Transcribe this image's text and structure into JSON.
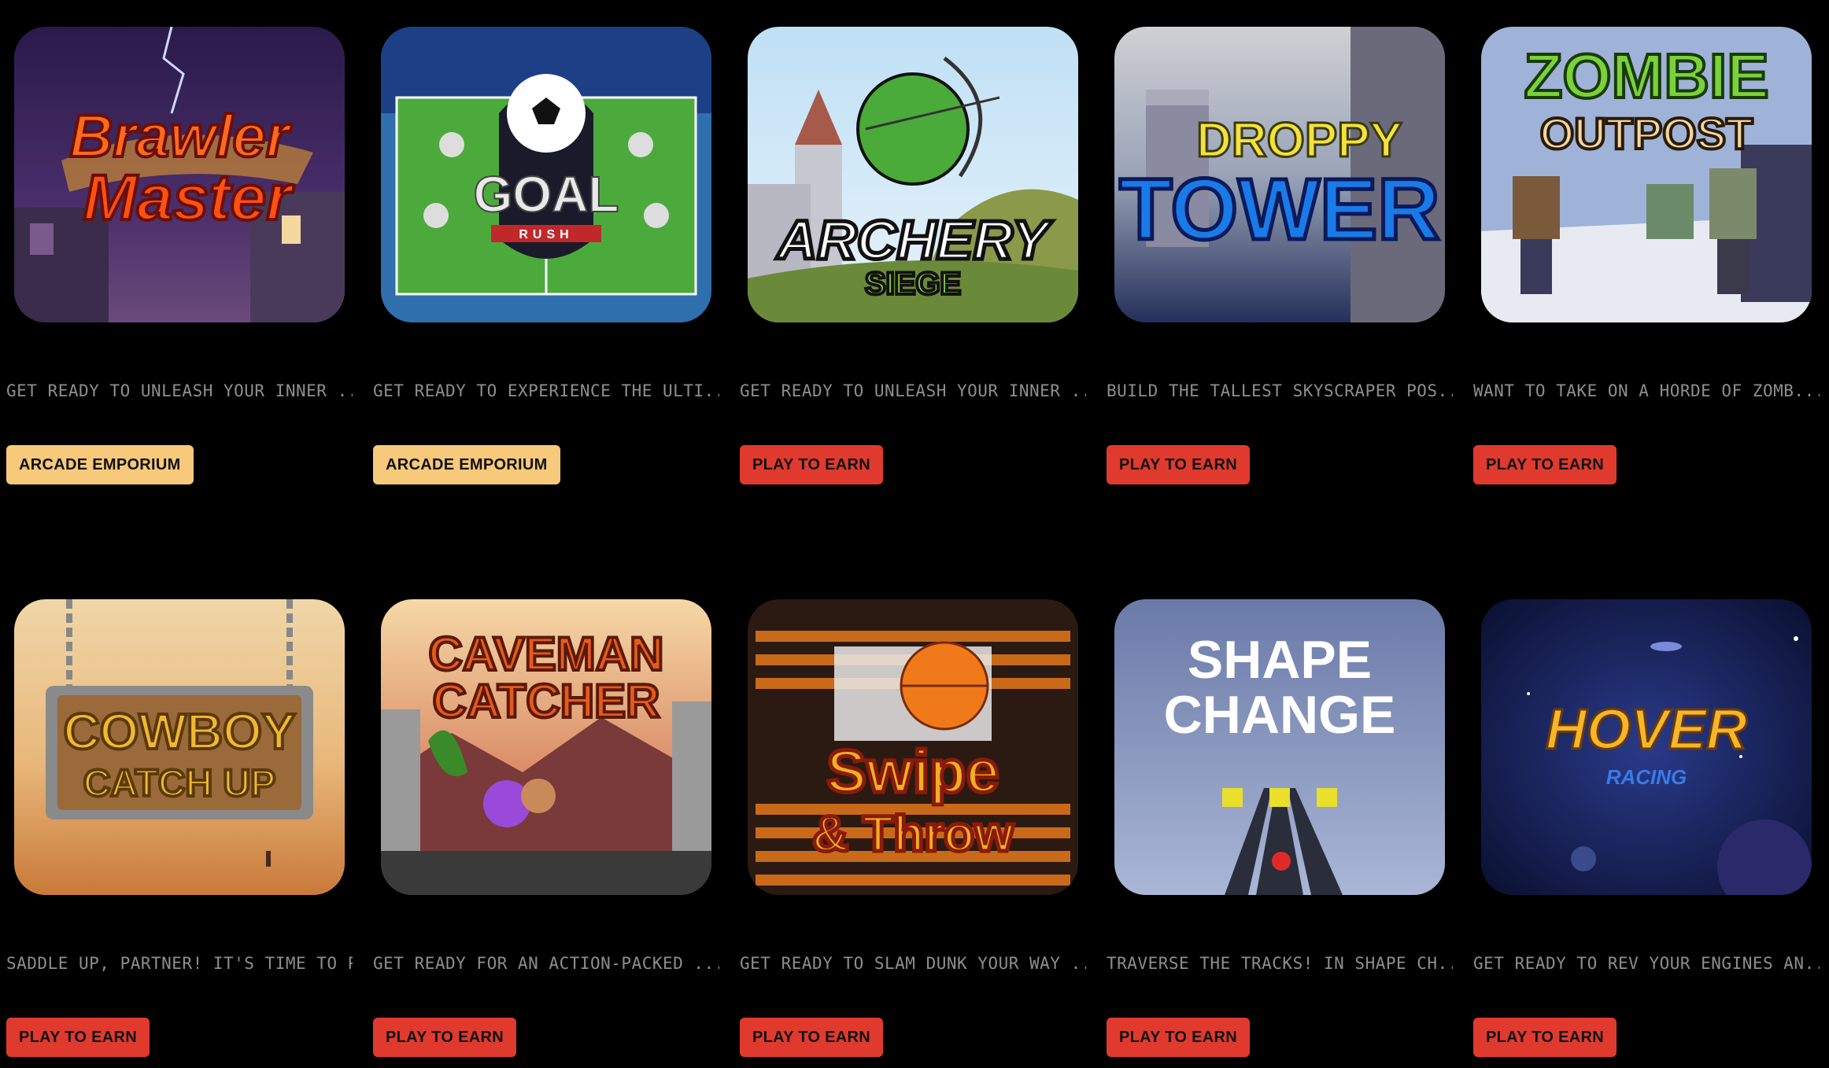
{
  "games": [
    {
      "title_line1": "Brawler",
      "title_line2": "Master",
      "description": "GET READY TO UNLEASH YOUR INNER ...",
      "tag": "ARCADE EMPORIUM",
      "tag_type": "arcade",
      "bg": "#3a2a5a"
    },
    {
      "title_line1": "GOAL",
      "title_line2": "RUSH",
      "description": "GET READY TO EXPERIENCE THE ULTI...",
      "tag": "ARCADE EMPORIUM",
      "tag_type": "arcade",
      "bg": "#3f8a3a"
    },
    {
      "title_line1": "ARCHERY",
      "title_line2": "SIEGE",
      "description": "GET READY TO UNLEASH YOUR INNER ...",
      "tag": "PLAY TO EARN",
      "tag_type": "earn",
      "bg": "#7fa7c9"
    },
    {
      "title_line1": "DROPPY",
      "title_line2": "TOWER",
      "description": "BUILD THE TALLEST SKYSCRAPER POS...",
      "tag": "PLAY TO EARN",
      "tag_type": "earn",
      "bg": "#2b3f6b"
    },
    {
      "title_line1": "ZOMBIE",
      "title_line2": "OUTPOST",
      "description": "WANT TO TAKE ON A HORDE OF ZOMB...",
      "tag": "PLAY TO EARN",
      "tag_type": "earn",
      "bg": "#8aa0c7"
    },
    {
      "title_line1": "COWBOY",
      "title_line2": "CATCH UP",
      "description": "SADDLE UP, PARTNER! IT'S TIME TO PU...",
      "tag": "PLAY TO EARN",
      "tag_type": "earn",
      "bg": "#d9a46a"
    },
    {
      "title_line1": "CAVEMAN",
      "title_line2": "CATCHER",
      "description": "GET READY FOR AN ACTION-PACKED ...",
      "tag": "PLAY TO EARN",
      "tag_type": "earn",
      "bg": "#a86a4a"
    },
    {
      "title_line1": "Swipe",
      "title_line2": "& Throw",
      "description": "GET READY TO SLAM DUNK YOUR WAY ...",
      "tag": "PLAY TO EARN",
      "tag_type": "earn",
      "bg": "#3a2418"
    },
    {
      "title_line1": "SHAPE",
      "title_line2": "CHANGE",
      "description": "TRAVERSE THE TRACKS! IN SHAPE CH...",
      "tag": "PLAY TO EARN",
      "tag_type": "earn",
      "bg": "#7a8ab3"
    },
    {
      "title_line1": "HOVER",
      "title_line2": "RACING",
      "description": "GET READY TO REV YOUR ENGINES AN...",
      "tag": "PLAY TO EARN",
      "tag_type": "earn",
      "bg": "#1b2350"
    }
  ],
  "colors": {
    "earn": "#e03a2f",
    "arcade": "#f7c97a",
    "background": "#000000",
    "description_text": "#8e8e8e"
  }
}
